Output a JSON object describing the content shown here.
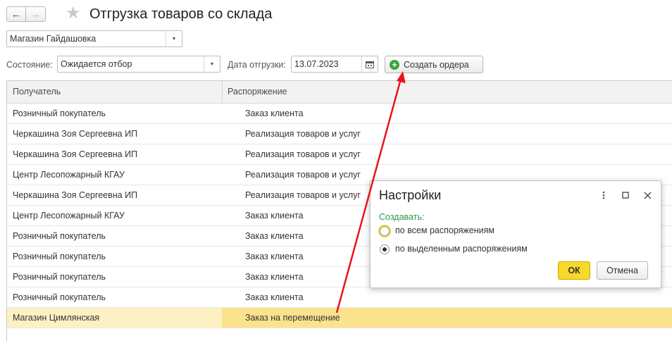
{
  "header": {
    "title": "Отгрузка товаров со склада",
    "back_icon": "←",
    "forward_icon": "→",
    "star_icon": "★"
  },
  "filters": {
    "warehouse": "Магазин Гайдашовка",
    "state_label": "Состояние:",
    "state_value": "Ожидается отбор",
    "date_label": "Дата отгрузки:",
    "date_value": "13.07.2023",
    "create_button": "Создать ордера"
  },
  "table": {
    "columns": [
      "Получатель",
      "Распоряжение"
    ],
    "rows": [
      {
        "recipient": "Розничный покупатель",
        "order": "Заказ клиента"
      },
      {
        "recipient": "Черкашина Зоя Сергеевна ИП",
        "order": "Реализация товаров и услуг"
      },
      {
        "recipient": "Черкашина Зоя Сергеевна ИП",
        "order": "Реализация товаров и услуг"
      },
      {
        "recipient": "Центр Лесопожарный КГАУ",
        "order": "Реализация товаров и услуг"
      },
      {
        "recipient": "Черкашина Зоя Сергеевна ИП",
        "order": "Реализация товаров и услуг"
      },
      {
        "recipient": "Центр Лесопожарный КГАУ",
        "order": "Заказ клиента"
      },
      {
        "recipient": "Розничный покупатель",
        "order": "Заказ клиента"
      },
      {
        "recipient": "Розничный покупатель",
        "order": "Заказ клиента"
      },
      {
        "recipient": "Розничный покупатель",
        "order": "Заказ клиента"
      },
      {
        "recipient": "Розничный покупатель",
        "order": "Заказ клиента"
      },
      {
        "recipient": "Магазин Цимлянская",
        "order": "Заказ на перемещение"
      }
    ],
    "selected_row": 10
  },
  "dialog": {
    "title": "Настройки",
    "group_label": "Создавать:",
    "option_all": "по всем распоряжениям",
    "option_selected": "по выделенным распоряжениям",
    "selected_option": "option_selected",
    "ok_button": "ОК",
    "cancel_button": "Отмена"
  },
  "colors": {
    "selected_row": "#fbe38d",
    "ok_button": "#f8d92a",
    "group_label": "#2c9a4a",
    "arrow": "#e8141b"
  }
}
